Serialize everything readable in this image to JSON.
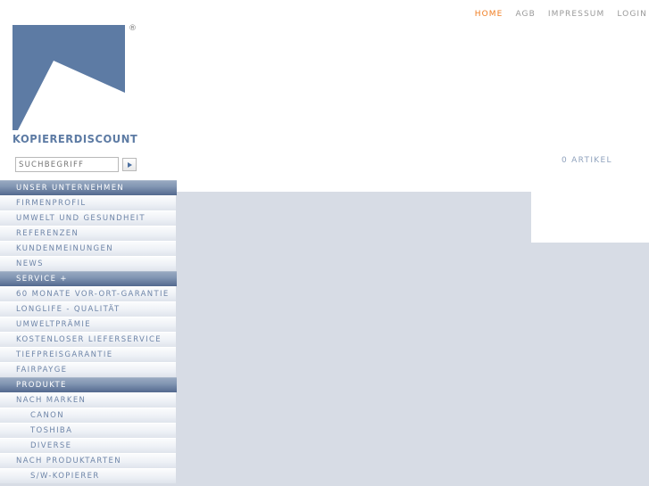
{
  "topnav": {
    "items": [
      {
        "label": "HOME",
        "active": true
      },
      {
        "label": "AGB",
        "active": false
      },
      {
        "label": "IMPRESSUM",
        "active": false
      },
      {
        "label": "LOGIN",
        "active": false
      }
    ]
  },
  "logo": {
    "wordmark": "KOPIERERDISCOUNT",
    "registered_mark": "®",
    "mark_color": "#5d7ba4"
  },
  "search": {
    "placeholder": "SUCHBEGRIFF",
    "value": "",
    "submit_icon": "play-triangle-icon"
  },
  "cart": {
    "label": "0 ARTIKEL"
  },
  "colors": {
    "accent": "#f07d22",
    "brand_blue": "#5d7ba4",
    "page_bg": "#d7dce5",
    "nav_header_bg": "#53698e",
    "nav_item_text": "#6e85a8"
  },
  "sidebar": {
    "sections": [
      {
        "header": "UNSER UNTERNEHMEN",
        "items": [
          {
            "label": "FIRMENPROFIL",
            "sub": false
          },
          {
            "label": "UMWELT UND GESUNDHEIT",
            "sub": false
          },
          {
            "label": "REFERENZEN",
            "sub": false
          },
          {
            "label": "KUNDENMEINUNGEN",
            "sub": false
          },
          {
            "label": "NEWS",
            "sub": false
          }
        ]
      },
      {
        "header": "SERVICE +",
        "items": [
          {
            "label": "60 MONATE VOR-ORT-GARANTIE",
            "sub": false
          },
          {
            "label": "LONGLIFE - QUALITÄT",
            "sub": false
          },
          {
            "label": "UMWELTPRÄMIE",
            "sub": false
          },
          {
            "label": "KOSTENLOSER LIEFERSERVICE",
            "sub": false
          },
          {
            "label": "TIEFPREISGARANTIE",
            "sub": false
          },
          {
            "label": "FAIRPAYGE",
            "sub": false
          }
        ]
      },
      {
        "header": "PRODUKTE",
        "items": [
          {
            "label": "NACH MARKEN",
            "sub": false
          },
          {
            "label": "CANON",
            "sub": true
          },
          {
            "label": "TOSHIBA",
            "sub": true
          },
          {
            "label": "DIVERSE",
            "sub": true
          },
          {
            "label": "NACH PRODUKTARTEN",
            "sub": false
          },
          {
            "label": "S/W-KOPIERER",
            "sub": true
          }
        ]
      }
    ]
  }
}
